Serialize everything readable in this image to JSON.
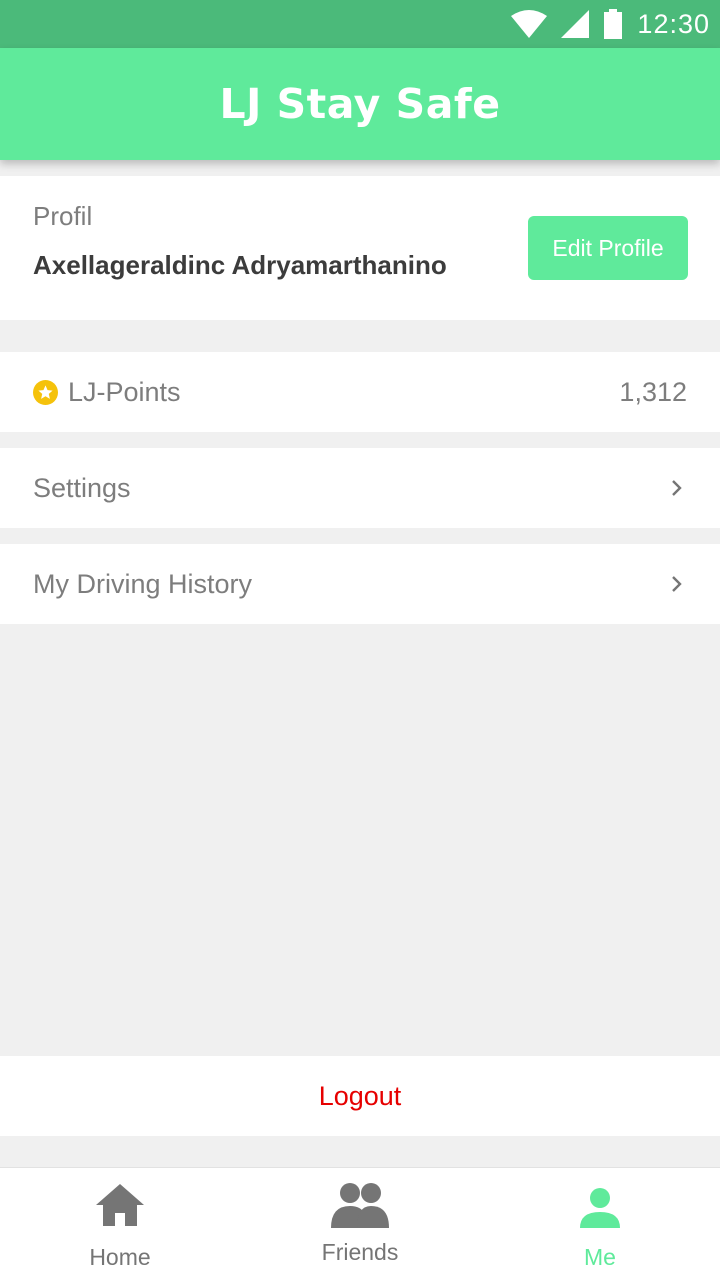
{
  "status_bar": {
    "time": "12:30",
    "icons": [
      "wifi-icon",
      "signal-icon",
      "battery-icon"
    ],
    "color": "#4bba7a"
  },
  "app_bar": {
    "title": "LJ Stay Safe",
    "color": "#5fea9b"
  },
  "profile": {
    "section_label": "Profil",
    "name": "Axellageraldinc Adryamarthanino",
    "edit_button_label": "Edit Profile"
  },
  "points": {
    "label": "LJ-Points",
    "value": "1,312",
    "icon": "star-icon",
    "icon_color": "#f5c20b"
  },
  "menu": {
    "settings_label": "Settings",
    "history_label": "My Driving History"
  },
  "logout": {
    "label": "Logout",
    "color": "#e60000"
  },
  "bottom_nav": {
    "items": [
      {
        "label": "Home",
        "icon": "home-icon"
      },
      {
        "label": "Friends",
        "icon": "friends-icon"
      },
      {
        "label": "Me",
        "icon": "person-icon",
        "active": true
      }
    ],
    "active_color": "#5fea9b",
    "inactive_color": "#757575"
  }
}
